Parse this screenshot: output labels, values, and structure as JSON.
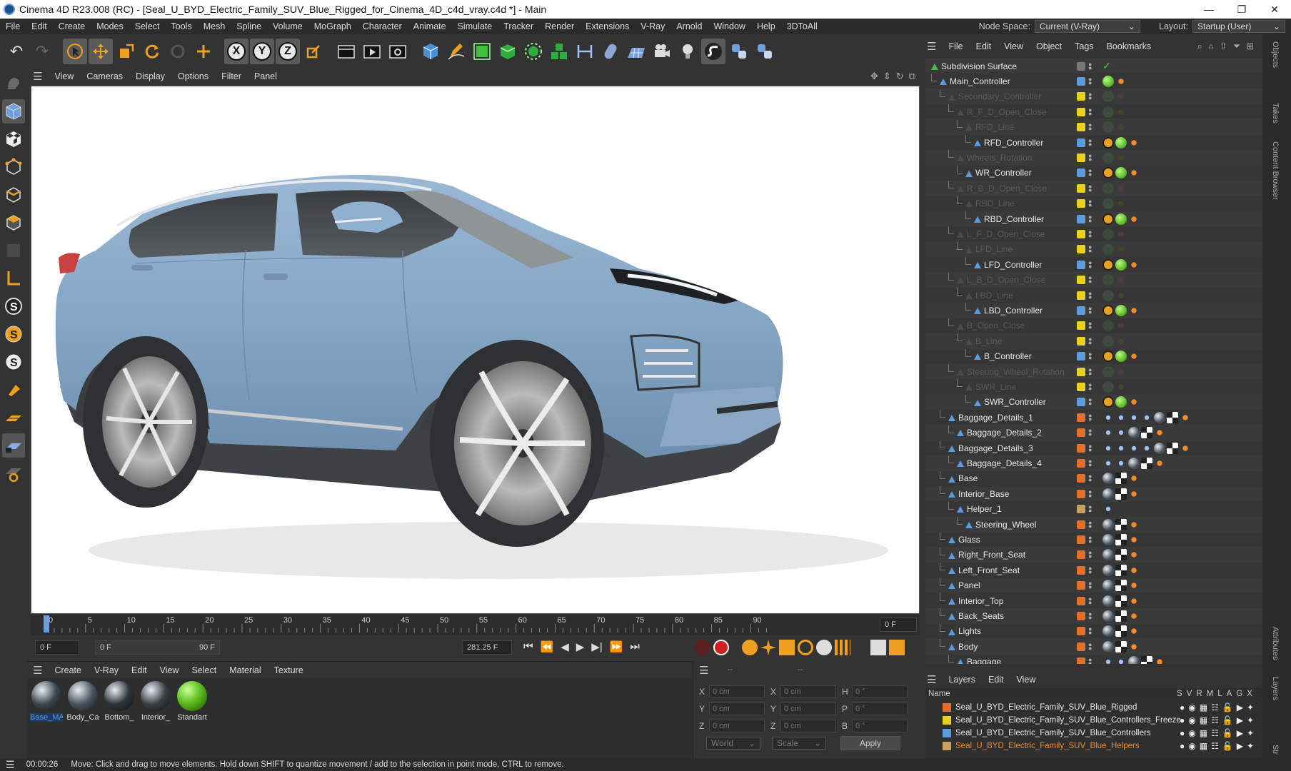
{
  "window": {
    "title": "Cinema 4D R23.008 (RC) - [Seal_U_BYD_Electric_Family_SUV_Blue_Rigged_for_Cinema_4D_c4d_vray.c4d *] - Main",
    "minimize": "—",
    "maximize": "❐",
    "close": "✕"
  },
  "menubar": {
    "items": [
      "File",
      "Edit",
      "Create",
      "Modes",
      "Select",
      "Tools",
      "Mesh",
      "Spline",
      "Volume",
      "MoGraph",
      "Character",
      "Animate",
      "Simulate",
      "Tracker",
      "Render",
      "Extensions",
      "V-Ray",
      "Arnold",
      "Window",
      "Help",
      "3DToAll"
    ],
    "node_space_label": "Node Space:",
    "node_space_value": "Current (V-Ray)",
    "layout_label": "Layout:",
    "layout_value": "Startup (User)"
  },
  "toolbar": {
    "undo": "↶",
    "redo": "↷",
    "x": "X",
    "y": "Y",
    "z": "Z"
  },
  "viewport": {
    "menu": [
      "View",
      "Cameras",
      "Display",
      "Options",
      "Filter",
      "Panel"
    ]
  },
  "timeline": {
    "ticks": [
      "0",
      "5",
      "10",
      "15",
      "20",
      "25",
      "30",
      "35",
      "40",
      "45",
      "50",
      "55",
      "60",
      "65",
      "70",
      "75",
      "80",
      "85",
      "90"
    ],
    "current_frame": "0 F",
    "start_field": "0 F",
    "range_start": "0 F",
    "range_end": "90 F",
    "fps_field": "281.25 F"
  },
  "material_manager": {
    "menu": [
      "Create",
      "V-Ray",
      "Edit",
      "View",
      "Select",
      "Material",
      "Texture"
    ],
    "materials": [
      {
        "name": "Base_MA",
        "color": "#3d4650"
      },
      {
        "name": "Body_Ca",
        "color": "#4a5460"
      },
      {
        "name": "Bottom_",
        "color": "#2f3438"
      },
      {
        "name": "Interior_",
        "color": "#3a3f44"
      },
      {
        "name": "Standart",
        "color": "#5fbf1f"
      }
    ]
  },
  "coordinates": {
    "rows": [
      {
        "a": "X",
        "av": "0 cm",
        "b": "X",
        "bv": "0 cm",
        "c": "H",
        "cv": "0 °"
      },
      {
        "a": "Y",
        "av": "0 cm",
        "b": "Y",
        "bv": "0 cm",
        "c": "P",
        "cv": "0 °"
      },
      {
        "a": "Z",
        "av": "0 cm",
        "b": "Z",
        "bv": "0 cm",
        "c": "B",
        "cv": "0 °"
      }
    ],
    "world": "World",
    "scale": "Scale",
    "apply": "Apply",
    "dash1": "--",
    "dash2": "--"
  },
  "object_manager": {
    "menu": [
      "File",
      "Edit",
      "View",
      "Object",
      "Tags",
      "Bookmarks"
    ],
    "objects": [
      {
        "name": "Subdivision Surface",
        "indent": 0,
        "dim": false,
        "layer": "none",
        "tags": "check"
      },
      {
        "name": "Main_Controller",
        "indent": 1,
        "dim": false,
        "layer": "#5b9be0",
        "tags": "ball"
      },
      {
        "name": "Secondary_Controller",
        "indent": 2,
        "dim": true,
        "layer": "lock",
        "tags": "dim"
      },
      {
        "name": "R_F_D_Open_Close",
        "indent": 3,
        "dim": true,
        "layer": "lock",
        "tags": "dim"
      },
      {
        "name": "RFD_Line",
        "indent": 4,
        "dim": true,
        "layer": "lock",
        "tags": "dim"
      },
      {
        "name": "RFD_Controller",
        "indent": 5,
        "dim": false,
        "layer": "#5b9be0",
        "tags": "ctrl"
      },
      {
        "name": "Wheels_Rotation",
        "indent": 3,
        "dim": true,
        "layer": "lock",
        "tags": "dim"
      },
      {
        "name": "WR_Controller",
        "indent": 4,
        "dim": false,
        "layer": "#5b9be0",
        "tags": "ctrl"
      },
      {
        "name": "R_B_D_Open_Close",
        "indent": 3,
        "dim": true,
        "layer": "lock",
        "tags": "dim"
      },
      {
        "name": "RBD_Line",
        "indent": 4,
        "dim": true,
        "layer": "lock",
        "tags": "dim"
      },
      {
        "name": "RBD_Controller",
        "indent": 5,
        "dim": false,
        "layer": "#5b9be0",
        "tags": "ctrl"
      },
      {
        "name": "L_F_D_Open_Close",
        "indent": 3,
        "dim": true,
        "layer": "lock",
        "tags": "dim"
      },
      {
        "name": "LFD_Line",
        "indent": 4,
        "dim": true,
        "layer": "lock",
        "tags": "dim"
      },
      {
        "name": "LFD_Controller",
        "indent": 5,
        "dim": false,
        "layer": "#5b9be0",
        "tags": "ctrl"
      },
      {
        "name": "L_B_D_Open_Close",
        "indent": 3,
        "dim": true,
        "layer": "lock",
        "tags": "dim"
      },
      {
        "name": "LBD_Line",
        "indent": 4,
        "dim": true,
        "layer": "lock",
        "tags": "dim"
      },
      {
        "name": "LBD_Controller",
        "indent": 5,
        "dim": false,
        "layer": "#5b9be0",
        "tags": "ctrl"
      },
      {
        "name": "B_Open_Close",
        "indent": 3,
        "dim": true,
        "layer": "lock",
        "tags": "dim"
      },
      {
        "name": "B_Line",
        "indent": 4,
        "dim": true,
        "layer": "lock",
        "tags": "dim"
      },
      {
        "name": "B_Controller",
        "indent": 5,
        "dim": false,
        "layer": "#5b9be0",
        "tags": "ctrl"
      },
      {
        "name": "Steering_Wheel_Rotation",
        "indent": 3,
        "dim": true,
        "layer": "lock",
        "tags": "dim"
      },
      {
        "name": "SWR_Line",
        "indent": 4,
        "dim": true,
        "layer": "lock",
        "tags": "dim"
      },
      {
        "name": "SWR_Controller",
        "indent": 5,
        "dim": false,
        "layer": "#5b9be0",
        "tags": "ctrl"
      },
      {
        "name": "Baggage_Details_1",
        "indent": 2,
        "dim": false,
        "layer": "#e0702a",
        "tags": "mesh4"
      },
      {
        "name": "Baggage_Details_2",
        "indent": 3,
        "dim": false,
        "layer": "#e0702a",
        "tags": "mesh2"
      },
      {
        "name": "Baggage_Details_3",
        "indent": 2,
        "dim": false,
        "layer": "#e0702a",
        "tags": "mesh4"
      },
      {
        "name": "Baggage_Details_4",
        "indent": 3,
        "dim": false,
        "layer": "#e0702a",
        "tags": "mesh2"
      },
      {
        "name": "Base",
        "indent": 2,
        "dim": false,
        "layer": "#e0702a",
        "tags": "mesh"
      },
      {
        "name": "Interior_Base",
        "indent": 2,
        "dim": false,
        "layer": "#e0702a",
        "tags": "mesh"
      },
      {
        "name": "Helper_1",
        "indent": 3,
        "dim": false,
        "layer": "#c8a060",
        "tags": "dots"
      },
      {
        "name": "Steering_Wheel",
        "indent": 4,
        "dim": false,
        "layer": "#e0702a",
        "tags": "mesh"
      },
      {
        "name": "Glass",
        "indent": 2,
        "dim": false,
        "layer": "#e0702a",
        "tags": "mesh"
      },
      {
        "name": "Right_Front_Seat",
        "indent": 2,
        "dim": false,
        "layer": "#e0702a",
        "tags": "mesh"
      },
      {
        "name": "Left_Front_Seat",
        "indent": 2,
        "dim": false,
        "layer": "#e0702a",
        "tags": "mesh"
      },
      {
        "name": "Panel",
        "indent": 2,
        "dim": false,
        "layer": "#e0702a",
        "tags": "mesh"
      },
      {
        "name": "Interior_Top",
        "indent": 2,
        "dim": false,
        "layer": "#e0702a",
        "tags": "mesh"
      },
      {
        "name": "Back_Seats",
        "indent": 2,
        "dim": false,
        "layer": "#e0702a",
        "tags": "mesh"
      },
      {
        "name": "Lights",
        "indent": 2,
        "dim": false,
        "layer": "#e0702a",
        "tags": "mesh"
      },
      {
        "name": "Body",
        "indent": 2,
        "dim": false,
        "layer": "#e0702a",
        "tags": "mesh"
      },
      {
        "name": "Baggage",
        "indent": 3,
        "dim": false,
        "layer": "#e0702a",
        "tags": "mesh2"
      }
    ]
  },
  "right_strip": [
    "Objects",
    "Takes",
    "Content Browser",
    "Attributes",
    "Layers",
    "Str"
  ],
  "layer_manager": {
    "menu": [
      "Layers",
      "Edit",
      "View"
    ],
    "header_name": "Name",
    "header_cols": [
      "S",
      "V",
      "R",
      "M",
      "L",
      "A",
      "G",
      "X"
    ],
    "layers": [
      {
        "name": "Seal_U_BYD_Electric_Family_SUV_Blue_Rigged",
        "color": "#e0702a",
        "text_color": "#e8e8e8"
      },
      {
        "name": "Seal_U_BYD_Electric_Family_SUV_Blue_Controllers_Freeze",
        "color": "#e8d020",
        "text_color": "#e8e8e8"
      },
      {
        "name": "Seal_U_BYD_Electric_Family_SUV_Blue_Controllers",
        "color": "#5b9be0",
        "text_color": "#e8e8e8"
      },
      {
        "name": "Seal_U_BYD_Electric_Family_SUV_Blue_Helpers",
        "color": "#c8a060",
        "text_color": "#f08a2a"
      }
    ]
  },
  "status": {
    "time": "00:00:26",
    "message": "Move: Click and drag to move elements. Hold down SHIFT to quantize movement / add to the selection in point mode, CTRL to remove."
  }
}
